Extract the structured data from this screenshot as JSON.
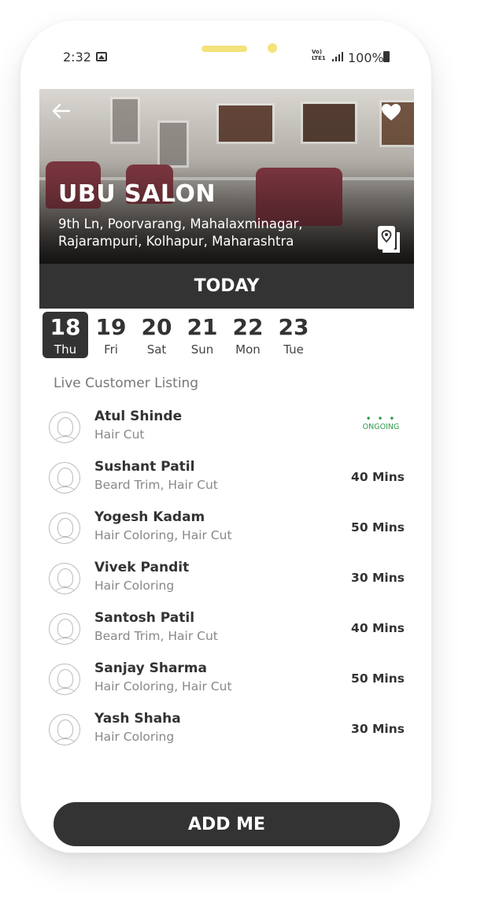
{
  "status_bar": {
    "time": "2:32",
    "network": "Vo) LTE1",
    "battery": "100%"
  },
  "salon": {
    "name": "UBU SALON",
    "address_line1": "9th Ln, Poorvarang, Mahalaxminagar,",
    "address_line2": "Rajarampuri, Kolhapur, Maharashtra"
  },
  "today_label": "TODAY",
  "dates": [
    {
      "num": "18",
      "day": "Thu",
      "selected": true
    },
    {
      "num": "19",
      "day": "Fri",
      "selected": false
    },
    {
      "num": "20",
      "day": "Sat",
      "selected": false
    },
    {
      "num": "21",
      "day": "Sun",
      "selected": false
    },
    {
      "num": "22",
      "day": "Mon",
      "selected": false
    },
    {
      "num": "23",
      "day": "Tue",
      "selected": false
    }
  ],
  "listing_label": "Live Customer Listing",
  "customers": [
    {
      "name": "Atul Shinde",
      "service": "Hair Cut",
      "status": "ONGOING",
      "status_dots": "• • •"
    },
    {
      "name": "Sushant Patil",
      "service": "Beard Trim, Hair Cut",
      "wait": "40 Mins"
    },
    {
      "name": "Yogesh Kadam",
      "service": "Hair Coloring, Hair Cut",
      "wait": "50 Mins"
    },
    {
      "name": "Vivek Pandit",
      "service": "Hair Coloring",
      "wait": "30 Mins"
    },
    {
      "name": "Santosh Patil",
      "service": "Beard Trim, Hair Cut",
      "wait": "40 Mins"
    },
    {
      "name": "Sanjay Sharma",
      "service": "Hair Coloring, Hair Cut",
      "wait": "50 Mins"
    },
    {
      "name": "Yash Shaha",
      "service": "Hair Coloring",
      "wait": "30 Mins"
    }
  ],
  "add_button": "ADD ME",
  "colors": {
    "dark": "#333333",
    "ongoing_green": "#2e9a4a",
    "notch_yellow": "#f4e27a"
  },
  "icons": {
    "back": "back-arrow-icon",
    "favorite": "heart-icon",
    "map": "map-pin-icon",
    "avatar": "user-avatar-icon"
  }
}
